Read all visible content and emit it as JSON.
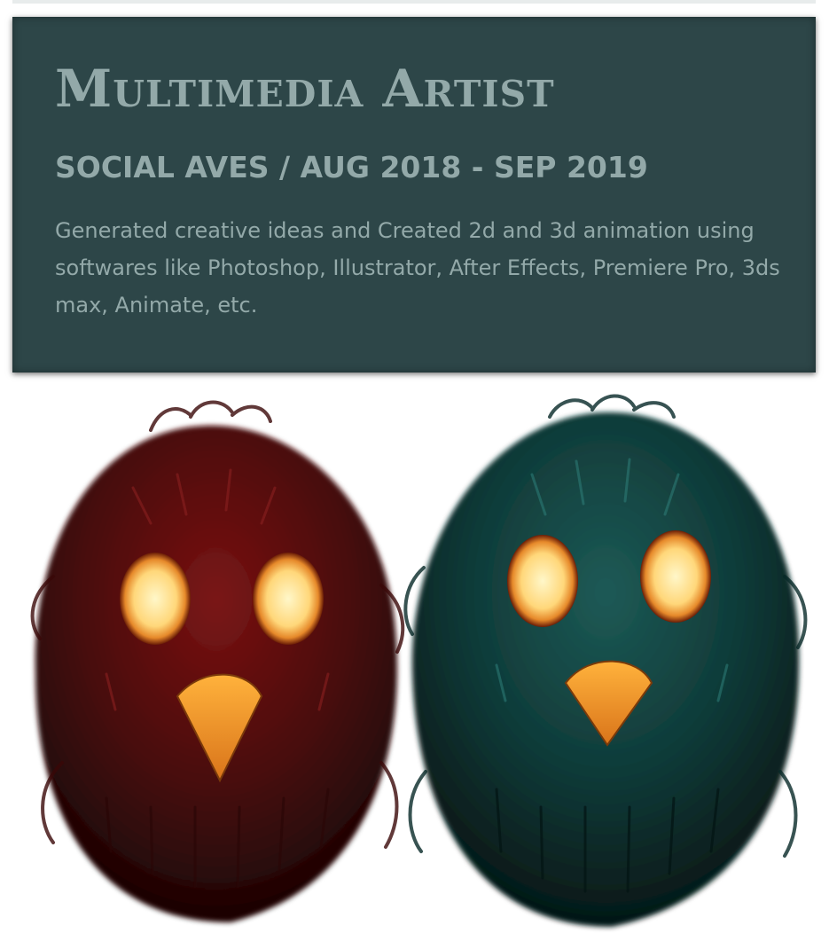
{
  "header": {
    "title": "Multimedia Artist",
    "subtitle": "SOCIAL AVES / AUG 2018 - SEP 2019",
    "description": "Generated creative ideas and Created 2d and 3d animation using softwares like Photoshop, Illustrator, After Effects, Premiere Pro, 3ds max, Animate, etc."
  },
  "artwork": {
    "left_bird": {
      "body_color": "#5a0c0c",
      "eye_color": "#ffd97a",
      "beak_color": "#f09a2a"
    },
    "right_bird": {
      "body_color": "#0d3a38",
      "eye_color": "#ffd97a",
      "beak_color": "#f09a2a"
    }
  }
}
